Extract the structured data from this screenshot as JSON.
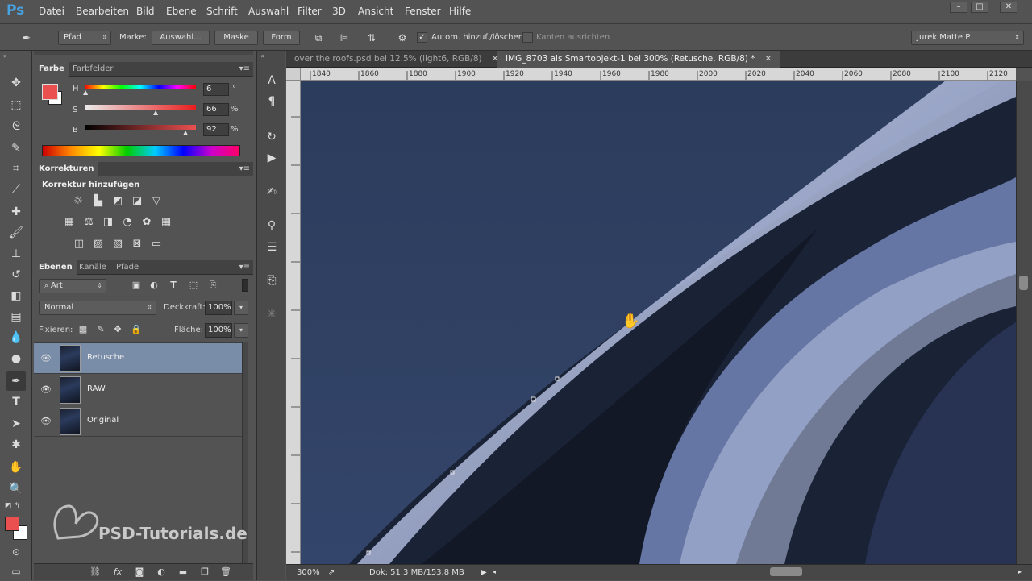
{
  "app": {
    "logo": "Ps"
  },
  "menu": [
    "Datei",
    "Bearbeiten",
    "Bild",
    "Ebene",
    "Schrift",
    "Auswahl",
    "Filter",
    "3D",
    "Ansicht",
    "Fenster",
    "Hilfe"
  ],
  "options": {
    "tool_mode": "Pfad",
    "make_label": "Marke:",
    "selection_btn": "Auswahl...",
    "mask_btn": "Maske",
    "shape_btn": "Form",
    "auto_add_delete": "Autom. hinzuf./löschen",
    "align_edges": "Kanten ausrichten",
    "workspace": "Jurek Matte P"
  },
  "color_panel": {
    "tabs": [
      "Farbe",
      "Farbfelder"
    ],
    "h_label": "H",
    "h_value": "6",
    "h_unit": "°",
    "s_label": "S",
    "s_value": "66",
    "s_unit": "%",
    "b_label": "B",
    "b_value": "92",
    "b_unit": "%",
    "fg_color": "#eb5050",
    "bg_color": "#ffffff"
  },
  "adjustments": {
    "tab": "Korrekturen",
    "heading": "Korrektur hinzufügen"
  },
  "layers_panel": {
    "tabs": [
      "Ebenen",
      "Kanäle",
      "Pfade"
    ],
    "filter": "Art",
    "blend_mode": "Normal",
    "opacity_label": "Deckkraft:",
    "opacity_value": "100%",
    "lock_label": "Fixieren:",
    "fill_label": "Fläche:",
    "fill_value": "100%",
    "layers": [
      {
        "name": "Retusche",
        "selected": true
      },
      {
        "name": "RAW",
        "selected": false
      },
      {
        "name": "Original",
        "selected": false
      }
    ]
  },
  "documents": {
    "tabs": [
      {
        "title": "over the roofs.psd bei 12.5% (light6, RGB/8)",
        "active": false
      },
      {
        "title": "IMG_8703 als Smartobjekt-1 bei 300% (Retusche, RGB/8) *",
        "active": true
      }
    ]
  },
  "ruler": {
    "top": [
      "1840",
      "1860",
      "1880",
      "1900",
      "1920",
      "1940",
      "1960",
      "1980",
      "2000",
      "2020",
      "2040",
      "2060",
      "2080",
      "2100",
      "2120"
    ]
  },
  "status": {
    "zoom": "300%",
    "doc": "Dok: 51.3 MB/153.8 MB"
  },
  "watermark": "PSD-Tutorials.de"
}
